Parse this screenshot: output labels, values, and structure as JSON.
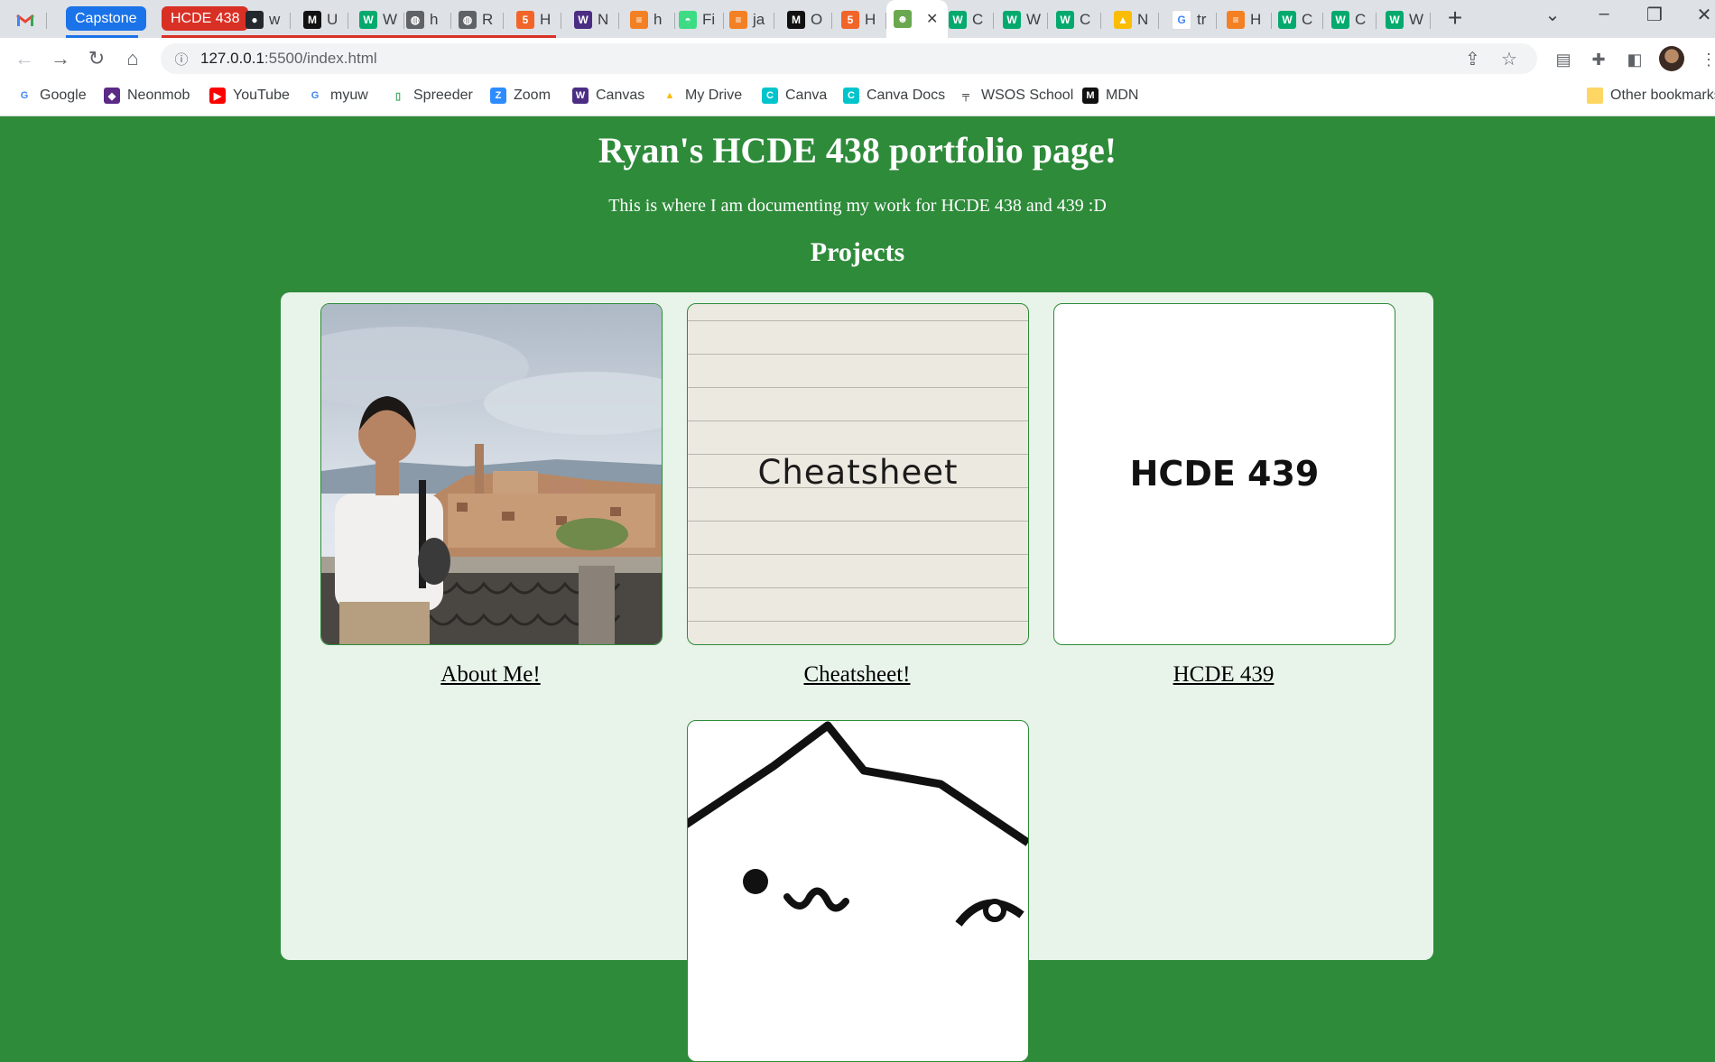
{
  "browser": {
    "tab_groups": [
      {
        "label": "Capstone",
        "color": "#1a73e8"
      },
      {
        "label": "HCDE 438",
        "color": "#d93025"
      }
    ],
    "tabs": [
      {
        "letter": "w",
        "icon": "github-icon"
      },
      {
        "letter": "U",
        "icon": "mdn-icon"
      },
      {
        "letter": "W",
        "icon": "w3schools-icon"
      },
      {
        "letter": "h",
        "icon": "globe-icon"
      },
      {
        "letter": "R",
        "icon": "globe-icon"
      },
      {
        "letter": "H",
        "icon": "html5-icon"
      },
      {
        "letter": "N",
        "icon": "uw-icon"
      },
      {
        "letter": "h",
        "icon": "stackoverflow-icon"
      },
      {
        "letter": "Fi",
        "icon": "android-icon"
      },
      {
        "letter": "ja",
        "icon": "stackoverflow-icon"
      },
      {
        "letter": "O",
        "icon": "mdn-icon"
      },
      {
        "letter": "H",
        "icon": "html5-icon"
      },
      {
        "letter": "",
        "icon": "frog-icon",
        "active": true
      },
      {
        "letter": "C",
        "icon": "w3schools-icon"
      },
      {
        "letter": "W",
        "icon": "w3schools-icon"
      },
      {
        "letter": "C",
        "icon": "w3schools-icon"
      },
      {
        "letter": "N",
        "icon": "google-drive-icon"
      },
      {
        "letter": "tr",
        "icon": "google-icon"
      },
      {
        "letter": "H",
        "icon": "stackoverflow-icon"
      },
      {
        "letter": "C",
        "icon": "w3schools-icon"
      },
      {
        "letter": "C",
        "icon": "w3schools-icon"
      },
      {
        "letter": "W",
        "icon": "w3schools-icon"
      }
    ],
    "url_host": "127.0.0.1",
    "url_rest": ":5500/index.html",
    "bookmarks": [
      {
        "label": "Google",
        "icon": "google-icon"
      },
      {
        "label": "Neonmob",
        "icon": "neonmob-icon"
      },
      {
        "label": "YouTube",
        "icon": "youtube-icon"
      },
      {
        "label": "myuw",
        "icon": "google-icon"
      },
      {
        "label": "Spreeder",
        "icon": "book-icon"
      },
      {
        "label": "Zoom",
        "icon": "zoom-icon"
      },
      {
        "label": "Canvas",
        "icon": "uw-icon"
      },
      {
        "label": "My Drive",
        "icon": "google-drive-icon"
      },
      {
        "label": "Canva",
        "icon": "canva-icon"
      },
      {
        "label": "Canva Docs",
        "icon": "canva-icon"
      },
      {
        "label": "WSOS School",
        "icon": "wsos-icon"
      },
      {
        "label": "MDN",
        "icon": "mdn-icon"
      }
    ],
    "other_bookmarks": "Other bookmarks"
  },
  "page": {
    "title": "Ryan's HCDE 438 portfolio page!",
    "subtitle": "This is where I am documenting my work for HCDE 438 and 439 :D",
    "section_heading": "Projects",
    "projects": [
      {
        "caption": "About Me!",
        "image": "photo-of-ryan-overlooking-town"
      },
      {
        "caption": "Cheatsheet!",
        "image_text": "Cheatsheet"
      },
      {
        "caption": "HCDE 439",
        "image_text": "HCDE 439"
      },
      {
        "caption": "",
        "image": "cartoon-cat"
      }
    ]
  },
  "colors": {
    "page_bg": "#2e8b3a",
    "panel_bg": "#e8f3ea",
    "card_border": "#2e8b3a"
  }
}
